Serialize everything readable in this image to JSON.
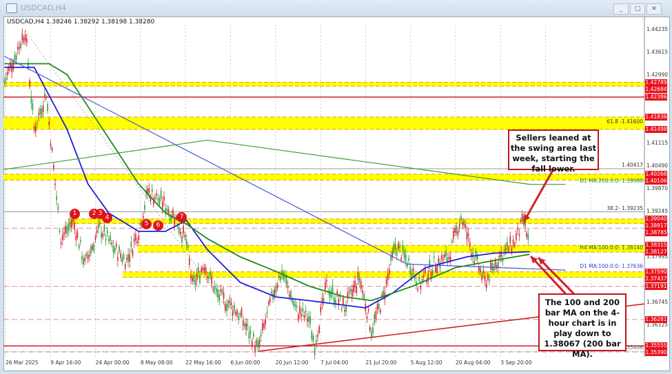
{
  "window": {
    "title": "USDCAD,H4",
    "buttons": [
      "_",
      "□",
      "✕"
    ]
  },
  "info_bar": {
    "text": "USDCAD,H4  1.38246 1.38292 1.38198 1.38280"
  },
  "colors": {
    "bull": "#2a9d3a",
    "bear": "#d0202a",
    "ma_h4_100": "#1a1fd6",
    "ma_h4_200": "#1a8a1a",
    "tag": "#e8121c",
    "zone": "#ffff00"
  },
  "chart_data": {
    "type": "line",
    "title": "USDCAD,H4",
    "ylim": [
      1.3539,
      1.44235
    ],
    "x_unit": "days since 26 Mar 2025",
    "x_ticks": [
      "26 Mar 2025",
      "9 Apr 16:00",
      "24 Apr 00:00",
      "8 May 08:00",
      "22 May 16:00",
      "6 Jun 00:00",
      "20 Jun 12:00",
      "7 Jul 04:00",
      "21 Jul 20:00",
      "5 Aug 12:00",
      "20 Aug 04:00",
      "3 Sep 20:00"
    ],
    "y_ticks": [
      "1.44235",
      "1.43615",
      "1.42990",
      "1.41115",
      "1.40490",
      "1.39870",
      "1.39245",
      "1.38620",
      "1.37995",
      "1.36745",
      "1.36125"
    ],
    "price": {
      "name": "USDCAD",
      "x": [
        -5,
        2,
        5,
        9,
        12,
        14,
        18,
        22,
        27,
        32,
        36,
        40,
        43,
        48,
        52,
        56,
        58,
        62,
        66,
        73,
        78,
        80,
        85,
        88,
        93,
        97,
        99,
        103,
        109,
        114,
        118,
        122,
        126,
        131,
        134,
        139,
        144,
        148,
        152,
        156,
        161,
        166,
        169,
        171
      ],
      "y": [
        1.428,
        1.442,
        1.415,
        1.425,
        1.4,
        1.385,
        1.39,
        1.378,
        1.388,
        1.382,
        1.379,
        1.387,
        1.398,
        1.395,
        1.391,
        1.384,
        1.372,
        1.378,
        1.37,
        1.365,
        1.358,
        1.3545,
        1.37,
        1.376,
        1.365,
        1.363,
        1.356,
        1.372,
        1.366,
        1.374,
        1.36,
        1.369,
        1.383,
        1.378,
        1.372,
        1.378,
        1.38,
        1.391,
        1.381,
        1.373,
        1.38,
        1.384,
        1.39,
        1.3828
      ]
    },
    "series": [
      {
        "name": "H4 MA 100",
        "color": "#1a1fd6",
        "x": [
          -5,
          5,
          16,
          23,
          30,
          40,
          49,
          56,
          63,
          74,
          86,
          97,
          116,
          125,
          136,
          150,
          159,
          171
        ],
        "y": [
          1.432,
          1.432,
          1.415,
          1.4,
          1.392,
          1.387,
          1.387,
          1.39,
          1.382,
          1.373,
          1.369,
          1.368,
          1.366,
          1.37,
          1.377,
          1.38,
          1.381,
          1.3814
        ]
      },
      {
        "name": "H4 MA 200",
        "color": "#1a8a1a",
        "x": [
          -5,
          10,
          16,
          28,
          40,
          49,
          56,
          63,
          74,
          86,
          97,
          109,
          118,
          132,
          146,
          159,
          171
        ],
        "y": [
          1.433,
          1.433,
          1.43,
          1.415,
          1.4,
          1.392,
          1.389,
          1.385,
          1.38,
          1.376,
          1.372,
          1.369,
          1.368,
          1.372,
          1.377,
          1.379,
          1.3807
        ]
      },
      {
        "name": "D1 MA 100",
        "color": "#4a55d8",
        "x": [
          -5,
          130,
          183
        ],
        "y": [
          1.435,
          1.378,
          1.37636
        ]
      },
      {
        "name": "D1 MA 200",
        "color": "#3a9a3a",
        "x": [
          -5,
          63,
          171,
          183
        ],
        "y": [
          1.404,
          1.412,
          1.3999,
          1.39988
        ]
      }
    ],
    "markers": [
      "1",
      "2",
      "3",
      "4",
      "5",
      "6",
      "7"
    ]
  },
  "levels": {
    "tags": [
      "1.42789",
      "1.42684",
      "1.42386",
      "1.41836",
      "1.41498",
      "1.40268",
      "1.40106",
      "1.39040",
      "1.38917",
      "1.38785",
      "1.38315",
      "1.38127",
      "1.37590",
      "1.37437",
      "1.37191",
      "1.36281",
      "1.35555",
      "1.35390"
    ],
    "line_labels": {
      "fib618": "61.8 -1.41600",
      "line_40417": "1.40417",
      "d1_ma200": "D1 MA:200:0:0: 1.39988",
      "fib382": "38.2- 1.39235",
      "h4_ma100": "H4 MA:100:0:0: 1.38140",
      "d1_ma100": "D1 MA:100:0:0: 1.37636",
      "fib0": "0.0- 1.35406"
    }
  },
  "annotations": {
    "sellers": "Sellers leaned at the swing area last week, starting the fall lower.",
    "ma": "The 100 and 200 bar MA on the 4-hour chart is in play down to 1.38067 (200 bar MA)."
  }
}
